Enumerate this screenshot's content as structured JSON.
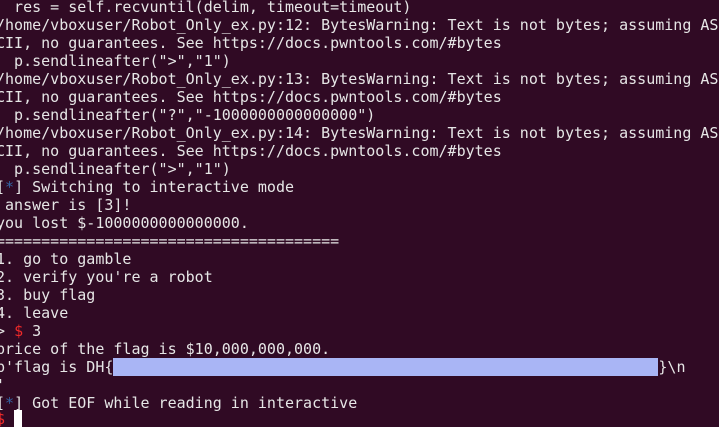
{
  "colors": {
    "background": "#300a24",
    "foreground": "#e6e6e6",
    "star": "#3465a4",
    "prompt_dollar": "#ef2929",
    "redaction": "#a9b5f5"
  },
  "terminal": {
    "line1": "  res = self.recvuntil(delim, timeout=timeout)",
    "line2": "/home/vboxuser/Robot_Only_ex.py:12: BytesWarning: Text is not bytes; assuming AS",
    "line3": "CII, no guarantees. See https://docs.pwntools.com/#bytes",
    "line4": "  p.sendlineafter(\">\",\"1\")",
    "line5": "/home/vboxuser/Robot_Only_ex.py:13: BytesWarning: Text is not bytes; assuming AS",
    "line6": "CII, no guarantees. See https://docs.pwntools.com/#bytes",
    "line7": "  p.sendlineafter(\"?\",\"-1000000000000000\")",
    "line8": "/home/vboxuser/Robot_Only_ex.py:14: BytesWarning: Text is not bytes; assuming AS",
    "line9": "CII, no guarantees. See https://docs.pwntools.com/#bytes",
    "line10": "  p.sendlineafter(\">\",\"1\")",
    "line11_open": "[",
    "line11_star": "*",
    "line11_rest": "] Switching to interactive mode",
    "line12": " answer is [3]!",
    "line13": "you lost $-1000000000000000.",
    "line14": "======================================",
    "line15": "1. go to gamble",
    "line16": "2. verify you're a robot",
    "line17": "3. buy flag",
    "line18": "4. leave",
    "line19_prompt": "> ",
    "line19_dollar": "$",
    "line19_input": " 3",
    "line20": "price of the flag is $10,000,000,000.",
    "line21_start": "b'flag is DH{",
    "line21_end": "}\\n",
    "line22": "'",
    "line23_open": "[",
    "line23_star": "*",
    "line23_rest": "] Got EOF while reading in interactive",
    "line24_dollar": "$",
    "line24_space": " "
  }
}
